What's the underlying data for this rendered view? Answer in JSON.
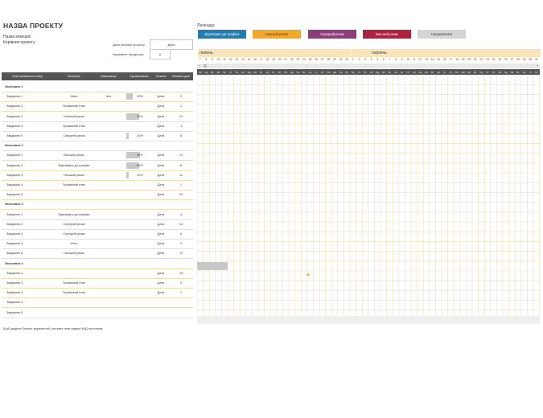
{
  "project": {
    "title": "НАЗВА ПРОЕКТУ",
    "company": "Назва компанії",
    "manager": "Керівник проекту",
    "start_label": "Дата початку проекту:",
    "start_value": "Дата",
    "increment_label": "Інкремент прокрутки:",
    "increment_value": "0"
  },
  "legend": {
    "title": "Легенда:",
    "items": [
      {
        "label": "Відповідно до графіка",
        "color": "#1f7fb5",
        "text": "#ffffff"
      },
      {
        "label": "Низький ризик",
        "color": "#f5a623",
        "text": "#3a3a3a"
      },
      {
        "label": "Середній ризик",
        "color": "#8e3d7a",
        "text": "#ffffff"
      },
      {
        "label": "Високий ризик",
        "color": "#b3203d",
        "text": "#ffffff"
      },
      {
        "label": "Непризначені",
        "color": "#d4d4d4",
        "text": "#3a3a3a"
      }
    ]
  },
  "table": {
    "headers": [
      "Опис проміжного етапу",
      "Категорія",
      "Виконавець",
      "Хід виконання",
      "Початок",
      "Кількість днів"
    ],
    "rows": [
      {
        "type": "group",
        "name": "Заголовок 1"
      },
      {
        "type": "task",
        "name": "Завдання 1",
        "category": "Мета",
        "assignee": "Ім'я",
        "progress": 25,
        "start": "Дата",
        "days": "3"
      },
      {
        "type": "task",
        "name": "Завдання 2",
        "category": "Проміжний етап",
        "assignee": "",
        "progress": null,
        "start": "Дата",
        "days": "1"
      },
      {
        "type": "task",
        "name": "Завдання 3",
        "category": "Низький ризик",
        "assignee": "",
        "progress": 50,
        "start": "Дата",
        "days": "10"
      },
      {
        "type": "task",
        "name": "Завдання 4",
        "category": "Проміжний етап",
        "assignee": "",
        "progress": null,
        "start": "Дата",
        "days": "1"
      },
      {
        "type": "task",
        "name": "Завдання 5",
        "category": "Середній ризик",
        "assignee": "",
        "progress": 10,
        "start": "Дата",
        "days": "6"
      },
      {
        "type": "group",
        "name": "Заголовок 2"
      },
      {
        "type": "task",
        "name": "Завдання 1",
        "category": "Високий ризик",
        "assignee": "",
        "progress": 60,
        "start": "Дата",
        "days": "13"
      },
      {
        "type": "task",
        "name": "Завдання 2",
        "category": "Відповідно до графіка",
        "assignee": "",
        "progress": 50,
        "start": "Дата",
        "days": "8"
      },
      {
        "type": "task",
        "name": "Завдання 3",
        "category": "Низький ризик",
        "assignee": "",
        "progress": 10,
        "start": "Дата",
        "days": "11"
      },
      {
        "type": "task",
        "name": "Завдання 4",
        "category": "Проміжний етап",
        "assignee": "",
        "progress": null,
        "start": "Дата",
        "days": "1"
      },
      {
        "type": "task",
        "name": "Завдання 5",
        "category": "",
        "assignee": "",
        "progress": null,
        "start": "Дата",
        "days": "24"
      },
      {
        "type": "group",
        "name": "Заголовок 3"
      },
      {
        "type": "task",
        "name": "Завдання 1",
        "category": "Відповідно до графіка",
        "assignee": "",
        "progress": null,
        "start": "Дата",
        "days": "4"
      },
      {
        "type": "task",
        "name": "Завдання 2",
        "category": "Середній ризик",
        "assignee": "",
        "progress": null,
        "start": "Дата",
        "days": "14"
      },
      {
        "type": "task",
        "name": "Завдання 3",
        "category": "Середній ризик",
        "assignee": "",
        "progress": null,
        "start": "Дата",
        "days": "6"
      },
      {
        "type": "task",
        "name": "Завдання 4",
        "category": "Мета",
        "assignee": "",
        "progress": null,
        "start": "Дата",
        "days": "3"
      },
      {
        "type": "task",
        "name": "Завдання 5",
        "category": "Низький ризик",
        "assignee": "",
        "progress": null,
        "start": "Дата",
        "days": "19"
      },
      {
        "type": "group",
        "name": "Заголовок 4"
      },
      {
        "type": "task",
        "name": "Завдання 1",
        "category": "",
        "assignee": "",
        "progress": null,
        "start": "Дата",
        "days": "15"
      },
      {
        "type": "task",
        "name": "Завдання 2",
        "category": "Проміжний етап",
        "assignee": "",
        "progress": null,
        "start": "Дата",
        "days": "5"
      },
      {
        "type": "task",
        "name": "Завдання 3",
        "category": "Проміжний етап",
        "assignee": "",
        "progress": null,
        "start": "Дата",
        "days": "1"
      },
      {
        "type": "task",
        "name": "Завдання 4",
        "category": "",
        "assignee": "",
        "progress": null,
        "start": "",
        "days": ""
      },
      {
        "type": "task",
        "name": "Завдання 5",
        "category": "",
        "assignee": "",
        "progress": null,
        "start": "",
        "days": ""
      }
    ]
  },
  "footnote": "Щоб додати більше відомостей, вставте нові рядки НАД поточним.",
  "gantt": {
    "months": [
      {
        "label": "липень",
        "start_index": 0
      },
      {
        "label": "серпень",
        "start_index": 25
      }
    ],
    "day_numbers": [
      "7",
      "8",
      "9",
      "10",
      "11",
      "12",
      "13",
      "14",
      "15",
      "16",
      "17",
      "18",
      "19",
      "20",
      "21",
      "22",
      "23",
      "24",
      "25",
      "26",
      "27",
      "28",
      "29",
      "30",
      "31",
      "1",
      "2",
      "3",
      "4",
      "5",
      "6",
      "7",
      "8",
      "9",
      "10",
      "11",
      "12",
      "13",
      "14",
      "15",
      "16",
      "17",
      "18",
      "19",
      "20",
      "21",
      "22",
      "23",
      "24",
      "25",
      "26",
      "27",
      "28",
      "29",
      "30",
      "31"
    ],
    "weekdays": [
      "Сб",
      "Нд",
      "Пн",
      "Вт",
      "Ср",
      "Чт",
      "Пт",
      "Сб",
      "Нд",
      "Пн",
      "Вт",
      "Ср",
      "Чт",
      "Пт",
      "Сб",
      "Нд",
      "Пн",
      "Вт",
      "Ср",
      "Чт",
      "Пт",
      "Сб",
      "Нд",
      "Пн",
      "Вт",
      "Ср",
      "Чт",
      "Пт",
      "Сб",
      "Нд",
      "Пн",
      "Вт",
      "Ср",
      "Чт",
      "Пт",
      "Сб",
      "Нд",
      "Пн",
      "Вт",
      "Ср",
      "Чт",
      "Пт",
      "Сб",
      "Нд",
      "Пн",
      "Вт",
      "Ср",
      "Чт",
      "Пт",
      "Сб",
      "Нд",
      "Пн",
      "Вт",
      "Ср",
      "Чт",
      "Пт"
    ],
    "scroll_left": "‹",
    "scroll_right": "›",
    "milestone_glyph": "▶",
    "bars": [
      {
        "row": 19,
        "start_day": 0,
        "length_days": 5
      }
    ],
    "milestones": [
      {
        "row": 20,
        "day": 18
      }
    ]
  }
}
